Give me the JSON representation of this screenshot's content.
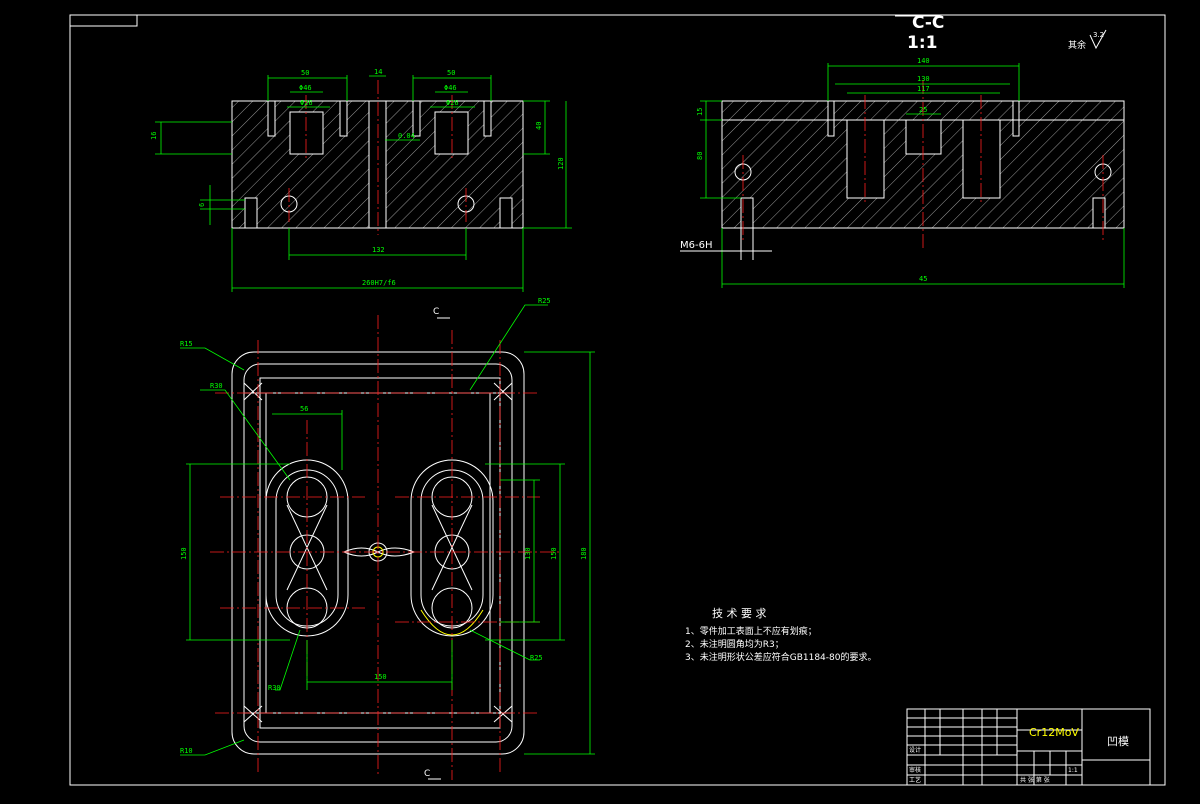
{
  "section_view": {
    "title": "C-C",
    "scale": "1:1"
  },
  "roughness": {
    "label": "其余",
    "value": "3.2"
  },
  "cut_marks": {
    "top": "C",
    "bottom": "C"
  },
  "thread_label": "M6-6H",
  "front_dims": {
    "d1": "50",
    "d2": "Φ46",
    "d3": "14",
    "d4": "50",
    "d5": "Φ46",
    "d6": "Φ26",
    "d7": "Φ26",
    "d8": "16",
    "d9": "40",
    "d10": "0.04",
    "d11": "120",
    "d12": "132",
    "d13": "260H7/f6",
    "d14": "6"
  },
  "section_dims": {
    "d1": "140",
    "d2": "130",
    "d3": "117",
    "d4": "25",
    "d5": "15",
    "d6": "80",
    "d7": "45"
  },
  "plan_dims": {
    "r_tl": "R15",
    "r_tr": "R25",
    "r_bl": "R10",
    "r_br": "R25",
    "r_in_l": "R30",
    "r_in_lb": "R30",
    "w1": "56",
    "h1": "150",
    "h2": "150",
    "h3": "130",
    "w2": "150",
    "h_total": "180"
  },
  "technical_requirements": {
    "heading": "技 术 要 求",
    "items": [
      "1、零件加工表面上不应有划痕；",
      "2、未注明圆角均为R3；",
      "3、未注明形状公差应符合GB1184-80的要求。"
    ]
  },
  "title_block": {
    "material": "Cr12MoV",
    "part_name": "凹模",
    "scale": "1:1",
    "rows": [
      "设计",
      "审核",
      "工艺"
    ],
    "sheet": "共 张 第 张"
  },
  "colors": {
    "outline": "#ffffff",
    "dimension": "#00ff00",
    "centerline": "#ff2020",
    "highlight": "#ffff00",
    "background": "#000000"
  }
}
